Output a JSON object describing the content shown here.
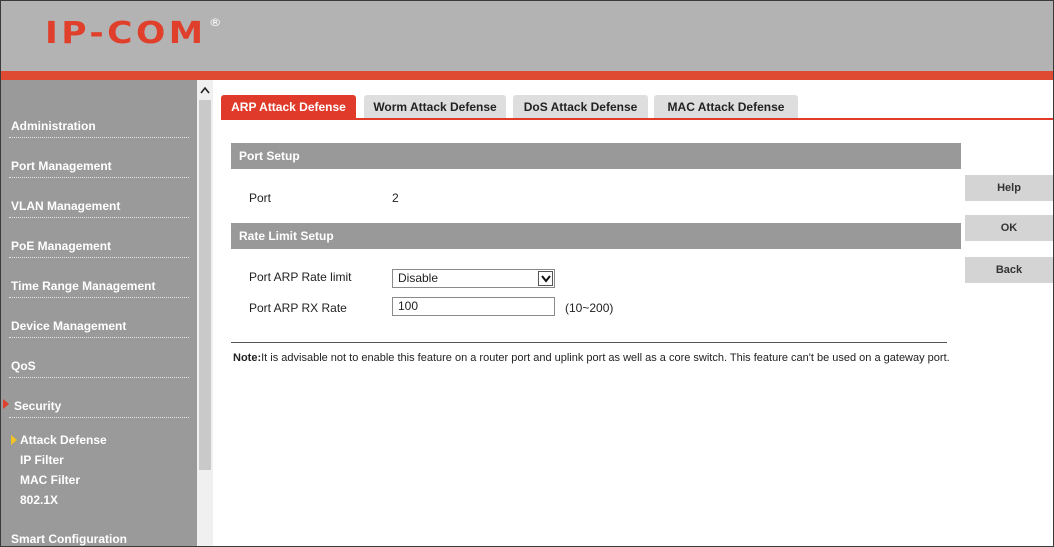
{
  "header": {
    "logo_text": "IP-COM",
    "logo_mark": "®",
    "brand_color": "#e0402b"
  },
  "sidebar": {
    "items": [
      {
        "label": "Administration"
      },
      {
        "label": "Port Management"
      },
      {
        "label": "VLAN Management"
      },
      {
        "label": "PoE Management"
      },
      {
        "label": "Time Range Management"
      },
      {
        "label": "Device Management"
      },
      {
        "label": "QoS"
      },
      {
        "label": "Security",
        "active": true
      }
    ],
    "submenu": [
      {
        "label": "Attack Defense",
        "active": true
      },
      {
        "label": "IP Filter"
      },
      {
        "label": "MAC Filter"
      },
      {
        "label": "802.1X"
      }
    ],
    "last_item": "Smart Configuration"
  },
  "tabs": [
    {
      "label": "ARP Attack Defense",
      "active": true
    },
    {
      "label": "Worm Attack Defense"
    },
    {
      "label": "DoS Attack Defense"
    },
    {
      "label": "MAC Attack Defense"
    }
  ],
  "port_setup": {
    "title": "Port Setup",
    "port_label": "Port",
    "port_value": "2"
  },
  "rate_limit": {
    "title": "Rate Limit Setup",
    "arp_rate_limit_label": "Port ARP Rate limit",
    "arp_rate_limit_value": "Disable",
    "rx_rate_label": "Port ARP RX Rate",
    "rx_rate_value": "100",
    "rx_rate_range": "(10~200)"
  },
  "note": {
    "prefix": "Note:",
    "text": "It is advisable not to enable this feature on a router port and uplink port as well as a core switch. This feature can't be used on a gateway port."
  },
  "actions": {
    "help": "Help",
    "ok": "OK",
    "back": "Back"
  },
  "colors": {
    "accent": "#e03a2b",
    "sidebar_bg": "#9a9a9a",
    "section_bg": "#999999"
  }
}
